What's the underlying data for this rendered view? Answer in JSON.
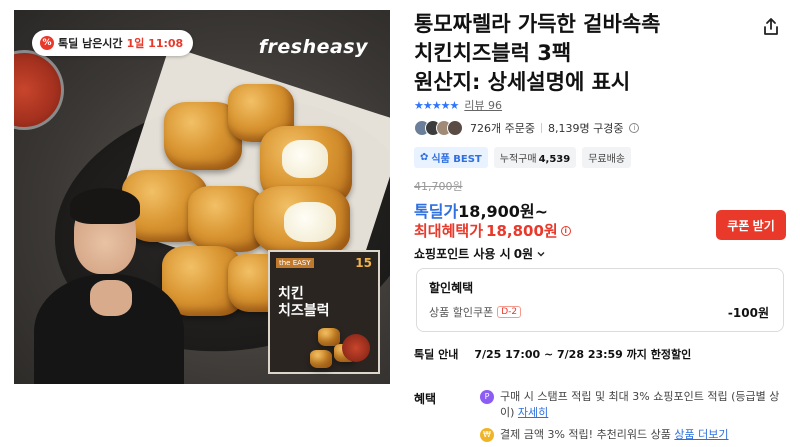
{
  "image": {
    "brand_logo": "fresheasy",
    "deal_badge": {
      "label": "톡딜 남은시간",
      "time": "1일 11:08"
    },
    "package": {
      "tag": "the EASY",
      "number": "15",
      "title_line1": "치킨",
      "title_line2": "치즈블럭"
    }
  },
  "product": {
    "title_line1": "통모짜렐라 가득한 겉바속촉",
    "title_line2": "치킨치즈블럭 3팩",
    "title_line3": "원산지: 상세설명에 표시"
  },
  "rating": {
    "stars": "★★★★★",
    "review_label": "리뷰 96"
  },
  "buyers": {
    "orders": "726개 주문중",
    "subscribers": "8,139명 구경중"
  },
  "tags": {
    "best": "식품 BEST",
    "cumulative_label": "누적구매",
    "cumulative_count": "4,539",
    "shipping": "무료배송"
  },
  "price": {
    "original": "41,700원",
    "deal_label": "톡딜가",
    "deal_price": "18,900원~",
    "max_label": "최대혜택가",
    "max_price": "18,800원",
    "coupon_button": "쿠폰 받기",
    "points_label": "쇼핑포인트 사용 시",
    "points_value": "0원"
  },
  "discount": {
    "title": "할인혜택",
    "item_label": "상품 할인쿠폰",
    "item_badge": "D-2",
    "item_amount": "-100원"
  },
  "deal_info": {
    "label": "톡딜 안내",
    "value": "7/25 17:00 ~ 7/28 23:59 까지 한정할인"
  },
  "benefits": {
    "label": "혜택",
    "item1_text": "구매 시 스탬프 적립 및 최대 3% 쇼핑포인트 적립 (등급별 상이)",
    "item1_link": "자세히",
    "item2_text": "결제 금액 3% 적립! 추천리워드 상품",
    "item2_link": "상품 더보기"
  },
  "colors": {
    "accent_red": "#e8392b",
    "accent_blue": "#2f6fde"
  }
}
